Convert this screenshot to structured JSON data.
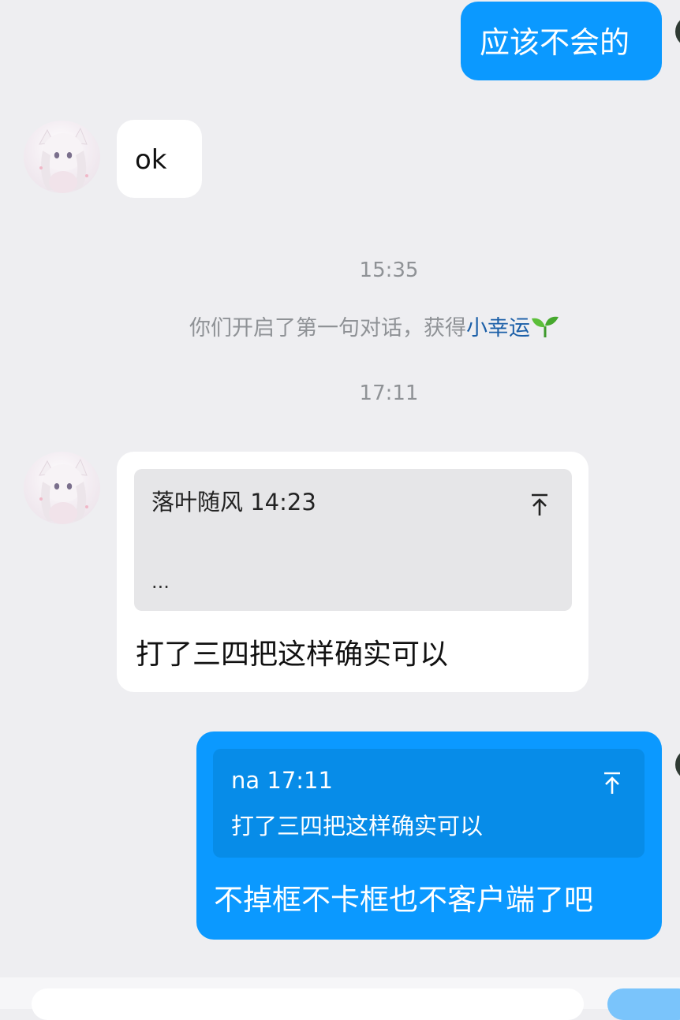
{
  "messages": {
    "out_1": {
      "text": "应该不会的"
    },
    "in_1": {
      "text": "ok"
    },
    "in_2": {
      "quote_header": "落叶随风 14:23",
      "quote_body": "...",
      "text": "打了三四把这样确实可以"
    },
    "out_2": {
      "quote_header": "na 17:11",
      "quote_body": "打了三四把这样确实可以",
      "text": "不掉框不卡框也不客户端了吧"
    }
  },
  "timestamps": {
    "first": "15:35",
    "second": "17:11"
  },
  "system_notice": {
    "prefix": "你们开启了第一句对话，获得",
    "link": "小幸运",
    "icon": "sprout-icon"
  },
  "colors": {
    "outgoing_bubble": "#0b99ff",
    "incoming_bubble": "#ffffff",
    "background": "#eeeef1",
    "link": "#1b5fa8"
  }
}
